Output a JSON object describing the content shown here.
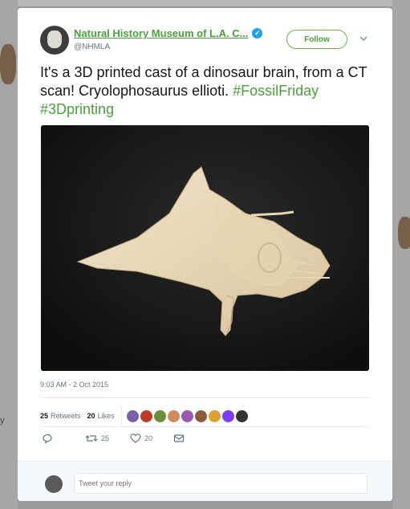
{
  "tweet": {
    "display_name": "Natural History Museum of L.A. C...",
    "handle": "@NHMLA",
    "follow_label": "Follow",
    "text_main": "It's a 3D printed cast of a dinosaur brain, from a CT scan! Cryolophosaurus ellioti.",
    "hashtag_1": "#FossilFriday",
    "hashtag_2": "#3Dprinting",
    "timestamp": "9:03 AM - 2 Oct 2015"
  },
  "stats": {
    "retweets_count": "25",
    "retweets_label": "Retweets",
    "likes_count": "20",
    "likes_label": "Likes"
  },
  "actions": {
    "retweet_count": "25",
    "like_count": "20"
  },
  "reply": {
    "placeholder": "Tweet your reply"
  },
  "background": {
    "left_text": "y"
  },
  "colors": {
    "accent_green": "#4aa03a",
    "verified_blue": "#1da1f2"
  },
  "icons": [
    "verified-icon",
    "chevron-down-icon",
    "reply-icon",
    "retweet-icon",
    "heart-icon",
    "dm-icon"
  ]
}
